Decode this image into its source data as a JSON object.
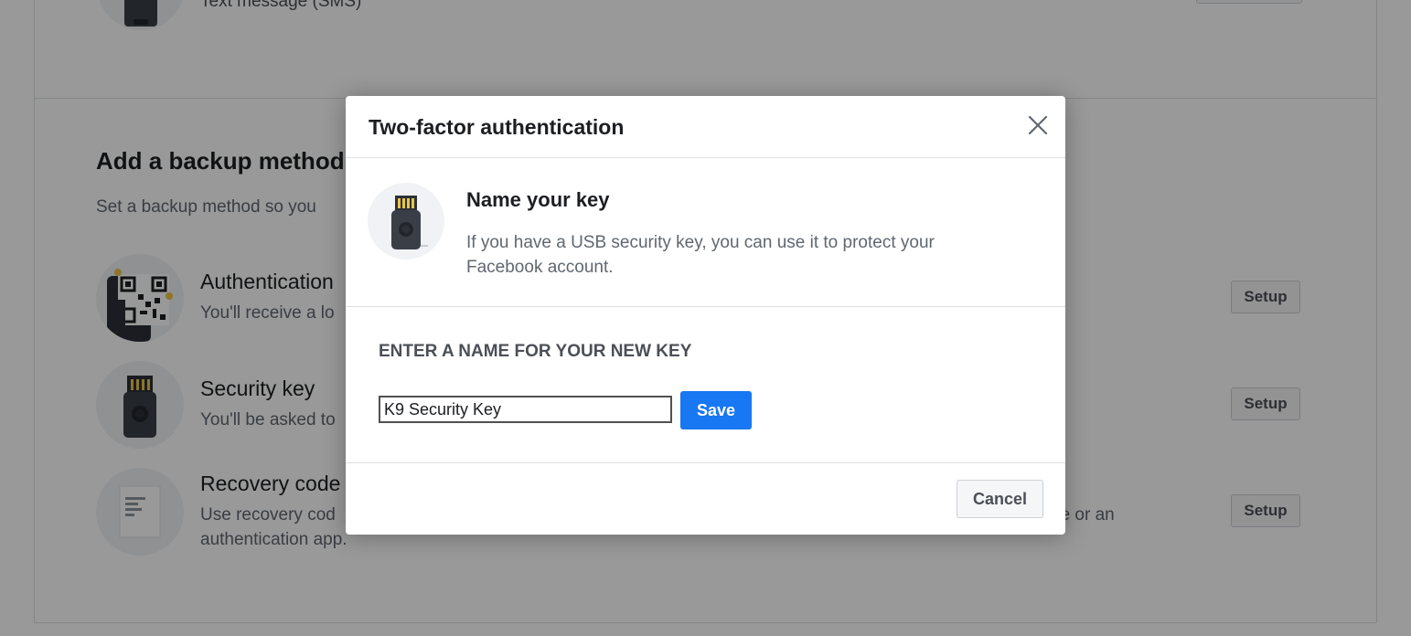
{
  "background": {
    "top_method_label": "Text message (SMS)",
    "section_title": "Add a backup method",
    "section_subtitle": "Set a backup method so you",
    "methods": [
      {
        "name": "Authentication",
        "desc": "You'll receive a lo",
        "setup_label": "Setup",
        "icon": "qr-code-phone-icon"
      },
      {
        "name": "Security key",
        "desc": "You'll be asked to",
        "setup_label": "Setup",
        "icon": "usb-key-icon"
      },
      {
        "name": "Recovery code",
        "desc_line1": "Use recovery cod",
        "desc_line1_tail": "ge or an",
        "desc_line2": "authentication app.",
        "setup_label": "Setup",
        "icon": "document-icon"
      }
    ]
  },
  "dialog": {
    "title": "Two-factor authentication",
    "close_icon": "close-icon",
    "intro": {
      "icon": "usb-key-icon",
      "heading": "Name your key",
      "text": "If you have a USB security key, you can use it to protect your Facebook account."
    },
    "field_label": "ENTER A NAME FOR YOUR NEW KEY",
    "key_name_value": "K9 Security Key",
    "save_label": "Save",
    "cancel_label": "Cancel"
  },
  "colors": {
    "primary": "#1877f2",
    "overlay": "rgba(0,0,0,0.4)",
    "text_primary": "#1c1e21",
    "text_secondary": "#606770"
  }
}
